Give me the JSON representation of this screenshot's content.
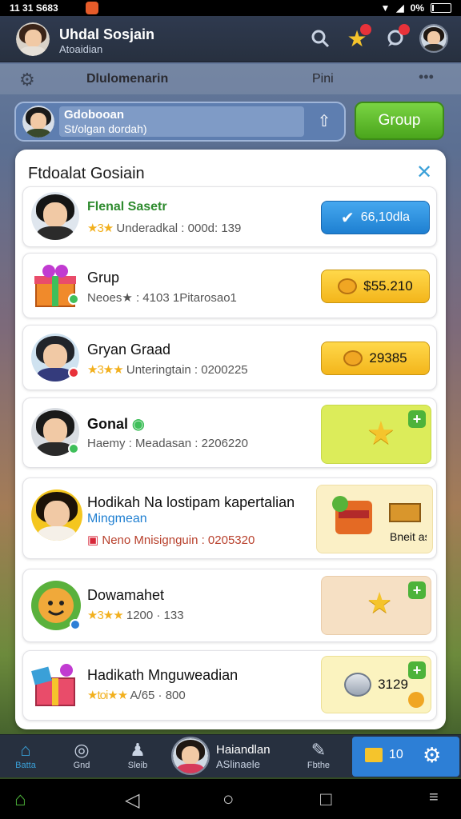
{
  "status_bar": {
    "time": "11 31 S683",
    "battery": "0%"
  },
  "header": {
    "name": "Uhdal Sosjain",
    "subtitle": "Atoaidian",
    "icons": [
      "search-icon",
      "star-icon",
      "chat-icon",
      "profile-avatar"
    ],
    "star_badge": "",
    "chat_badge": ""
  },
  "tabs": {
    "left": "Dlulomenarin",
    "right": "Pini"
  },
  "group_bar": {
    "title": "Gdobooan",
    "subtitle": "St/olgan dordah)",
    "button": "Group"
  },
  "panel": {
    "title": "Ftdoalat Gosiain",
    "rows": [
      {
        "name": "Flenal Sasetr",
        "sub_stars": "★3★",
        "sub": "Underadkal : 000d: 139",
        "action": "66,10dla"
      },
      {
        "name": "Grup",
        "sub": "Neoes★ : 4103 1Pitarosao1",
        "action": "$55.210"
      },
      {
        "name": "Gryan Graad",
        "sub_stars": "★3★★",
        "sub": "Unteringtain : 0200225",
        "action": "29385"
      },
      {
        "name": "Gonal",
        "sub": "Haemy : Meadasan : 2206220",
        "action": ""
      },
      {
        "name": "Hodikah Na lostipam kapertalian",
        "sub2": "Mingmean",
        "sub": "Neno Mnisignguin : 0205320",
        "action": "Bneit as"
      },
      {
        "name": "Dowamahet",
        "sub_stars": "★3★★",
        "sub": "1200 · 133",
        "action": ""
      },
      {
        "name": "Hadikath Mnguweadian",
        "sub_stars": "★toi★★",
        "sub": "A/65 · 800",
        "action": "3129"
      }
    ]
  },
  "bottom_nav": {
    "items": [
      "Batta",
      "Gnd",
      "Sleib"
    ],
    "name": "Haiandlan",
    "sub": "ASlinaele",
    "right_label": "Fbthe",
    "cta_count": "10"
  }
}
